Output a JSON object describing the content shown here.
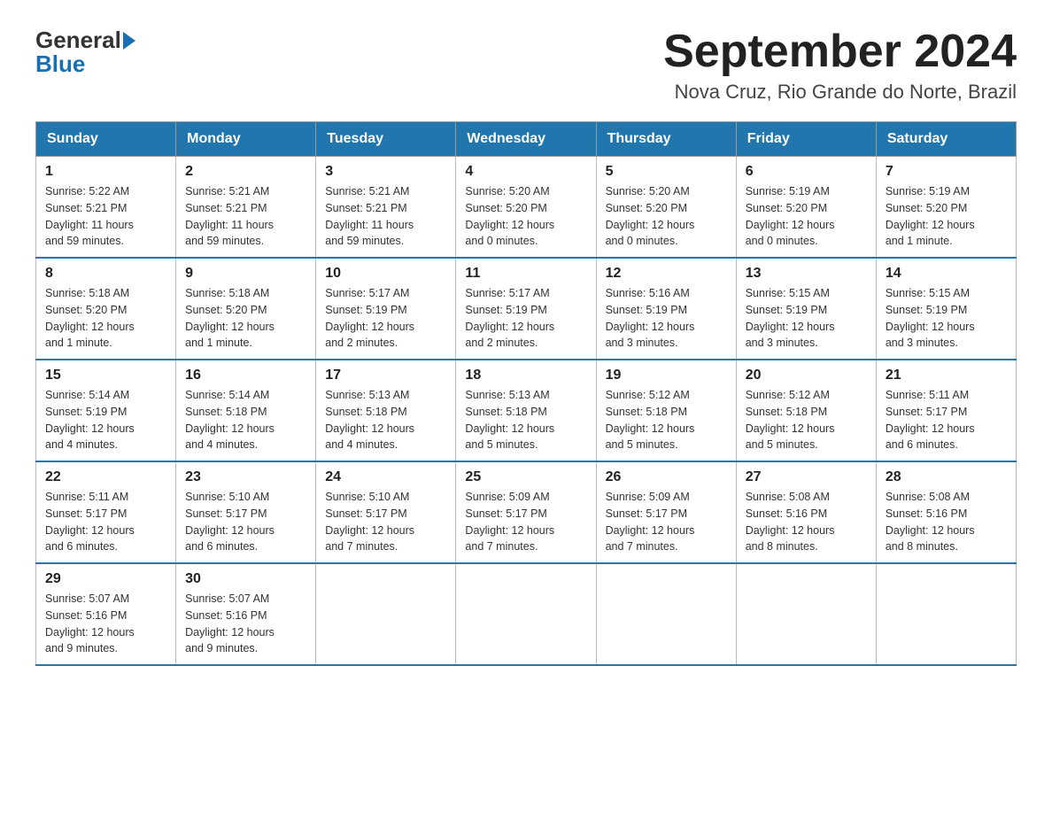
{
  "header": {
    "logo_general": "General",
    "logo_blue": "Blue",
    "month_title": "September 2024",
    "location": "Nova Cruz, Rio Grande do Norte, Brazil"
  },
  "weekdays": [
    "Sunday",
    "Monday",
    "Tuesday",
    "Wednesday",
    "Thursday",
    "Friday",
    "Saturday"
  ],
  "weeks": [
    [
      {
        "day": "1",
        "sunrise": "5:22 AM",
        "sunset": "5:21 PM",
        "daylight": "11 hours and 59 minutes."
      },
      {
        "day": "2",
        "sunrise": "5:21 AM",
        "sunset": "5:21 PM",
        "daylight": "11 hours and 59 minutes."
      },
      {
        "day": "3",
        "sunrise": "5:21 AM",
        "sunset": "5:21 PM",
        "daylight": "11 hours and 59 minutes."
      },
      {
        "day": "4",
        "sunrise": "5:20 AM",
        "sunset": "5:20 PM",
        "daylight": "12 hours and 0 minutes."
      },
      {
        "day": "5",
        "sunrise": "5:20 AM",
        "sunset": "5:20 PM",
        "daylight": "12 hours and 0 minutes."
      },
      {
        "day": "6",
        "sunrise": "5:19 AM",
        "sunset": "5:20 PM",
        "daylight": "12 hours and 0 minutes."
      },
      {
        "day": "7",
        "sunrise": "5:19 AM",
        "sunset": "5:20 PM",
        "daylight": "12 hours and 1 minute."
      }
    ],
    [
      {
        "day": "8",
        "sunrise": "5:18 AM",
        "sunset": "5:20 PM",
        "daylight": "12 hours and 1 minute."
      },
      {
        "day": "9",
        "sunrise": "5:18 AM",
        "sunset": "5:20 PM",
        "daylight": "12 hours and 1 minute."
      },
      {
        "day": "10",
        "sunrise": "5:17 AM",
        "sunset": "5:19 PM",
        "daylight": "12 hours and 2 minutes."
      },
      {
        "day": "11",
        "sunrise": "5:17 AM",
        "sunset": "5:19 PM",
        "daylight": "12 hours and 2 minutes."
      },
      {
        "day": "12",
        "sunrise": "5:16 AM",
        "sunset": "5:19 PM",
        "daylight": "12 hours and 3 minutes."
      },
      {
        "day": "13",
        "sunrise": "5:15 AM",
        "sunset": "5:19 PM",
        "daylight": "12 hours and 3 minutes."
      },
      {
        "day": "14",
        "sunrise": "5:15 AM",
        "sunset": "5:19 PM",
        "daylight": "12 hours and 3 minutes."
      }
    ],
    [
      {
        "day": "15",
        "sunrise": "5:14 AM",
        "sunset": "5:19 PM",
        "daylight": "12 hours and 4 minutes."
      },
      {
        "day": "16",
        "sunrise": "5:14 AM",
        "sunset": "5:18 PM",
        "daylight": "12 hours and 4 minutes."
      },
      {
        "day": "17",
        "sunrise": "5:13 AM",
        "sunset": "5:18 PM",
        "daylight": "12 hours and 4 minutes."
      },
      {
        "day": "18",
        "sunrise": "5:13 AM",
        "sunset": "5:18 PM",
        "daylight": "12 hours and 5 minutes."
      },
      {
        "day": "19",
        "sunrise": "5:12 AM",
        "sunset": "5:18 PM",
        "daylight": "12 hours and 5 minutes."
      },
      {
        "day": "20",
        "sunrise": "5:12 AM",
        "sunset": "5:18 PM",
        "daylight": "12 hours and 5 minutes."
      },
      {
        "day": "21",
        "sunrise": "5:11 AM",
        "sunset": "5:17 PM",
        "daylight": "12 hours and 6 minutes."
      }
    ],
    [
      {
        "day": "22",
        "sunrise": "5:11 AM",
        "sunset": "5:17 PM",
        "daylight": "12 hours and 6 minutes."
      },
      {
        "day": "23",
        "sunrise": "5:10 AM",
        "sunset": "5:17 PM",
        "daylight": "12 hours and 6 minutes."
      },
      {
        "day": "24",
        "sunrise": "5:10 AM",
        "sunset": "5:17 PM",
        "daylight": "12 hours and 7 minutes."
      },
      {
        "day": "25",
        "sunrise": "5:09 AM",
        "sunset": "5:17 PM",
        "daylight": "12 hours and 7 minutes."
      },
      {
        "day": "26",
        "sunrise": "5:09 AM",
        "sunset": "5:17 PM",
        "daylight": "12 hours and 7 minutes."
      },
      {
        "day": "27",
        "sunrise": "5:08 AM",
        "sunset": "5:16 PM",
        "daylight": "12 hours and 8 minutes."
      },
      {
        "day": "28",
        "sunrise": "5:08 AM",
        "sunset": "5:16 PM",
        "daylight": "12 hours and 8 minutes."
      }
    ],
    [
      {
        "day": "29",
        "sunrise": "5:07 AM",
        "sunset": "5:16 PM",
        "daylight": "12 hours and 9 minutes."
      },
      {
        "day": "30",
        "sunrise": "5:07 AM",
        "sunset": "5:16 PM",
        "daylight": "12 hours and 9 minutes."
      },
      null,
      null,
      null,
      null,
      null
    ]
  ]
}
